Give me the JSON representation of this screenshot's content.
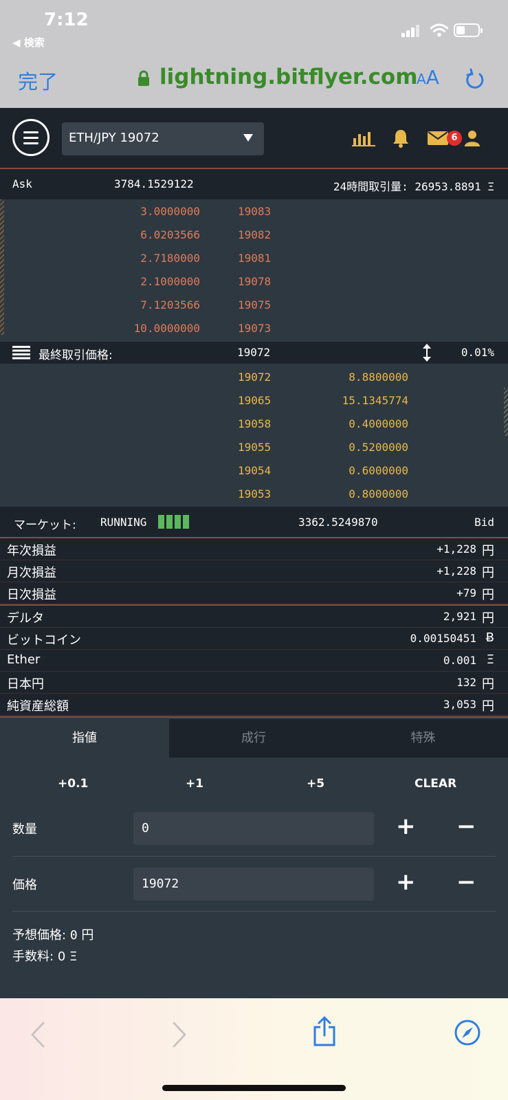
{
  "status": {
    "time": "7:12",
    "back": "◀ 検索"
  },
  "browser": {
    "done": "完了",
    "url": "lightning.bitflyer.com",
    "text_size_small": "A",
    "text_size_large": "A"
  },
  "header": {
    "pair": "ETH/JPY 19072",
    "mail_count": "6"
  },
  "ask": {
    "label": "Ask",
    "total": "3784.1529122",
    "volume_label": "24時間取引量:",
    "volume": "26953.8891 Ξ"
  },
  "asks": [
    {
      "size": "3.0000000",
      "price": "19083"
    },
    {
      "size": "6.0203566",
      "price": "19082"
    },
    {
      "size": "2.7180000",
      "price": "19081"
    },
    {
      "size": "2.1000000",
      "price": "19078"
    },
    {
      "size": "7.1203566",
      "price": "19075"
    },
    {
      "size": "10.0000000",
      "price": "19073"
    }
  ],
  "last": {
    "label": "最終取引価格:",
    "price": "19072",
    "change": "0.01%"
  },
  "bids": [
    {
      "price": "19072",
      "size": "8.8800000"
    },
    {
      "price": "19065",
      "size": "15.1345774"
    },
    {
      "price": "19058",
      "size": "0.4000000"
    },
    {
      "price": "19055",
      "size": "0.5200000"
    },
    {
      "price": "19054",
      "size": "0.6000000"
    },
    {
      "price": "19053",
      "size": "0.8000000"
    }
  ],
  "market": {
    "label": "マーケット:",
    "status": "RUNNING",
    "bid_total": "3362.5249870",
    "bid_label": "Bid"
  },
  "balances": [
    {
      "label": "年次損益",
      "value": "+1,228",
      "unit": "円"
    },
    {
      "label": "月次損益",
      "value": "+1,228",
      "unit": "円"
    },
    {
      "label": "日次損益",
      "value": "+79",
      "unit": "円"
    },
    {
      "label": "デルタ",
      "value": "2,921",
      "unit": "円"
    },
    {
      "label": "ビットコイン",
      "value": "0.00150451",
      "unit": "Ƀ"
    },
    {
      "label": "Ether",
      "value": "0.001",
      "unit": "Ξ"
    },
    {
      "label": "日本円",
      "value": "132",
      "unit": "円"
    },
    {
      "label": "純資産総額",
      "value": "3,053",
      "unit": "円"
    }
  ],
  "tabs": [
    "指値",
    "成行",
    "特殊"
  ],
  "increments": [
    "+0.1",
    "+1",
    "+5",
    "CLEAR"
  ],
  "form": {
    "quantity_label": "数量",
    "quantity_value": "0",
    "price_label": "価格",
    "price_value": "19072",
    "plus": "+",
    "minus": "−",
    "estimate_label": "予想価格:",
    "estimate_value": "0",
    "estimate_unit": "円",
    "fee_label": "手数料:",
    "fee_value": "0 Ξ"
  }
}
